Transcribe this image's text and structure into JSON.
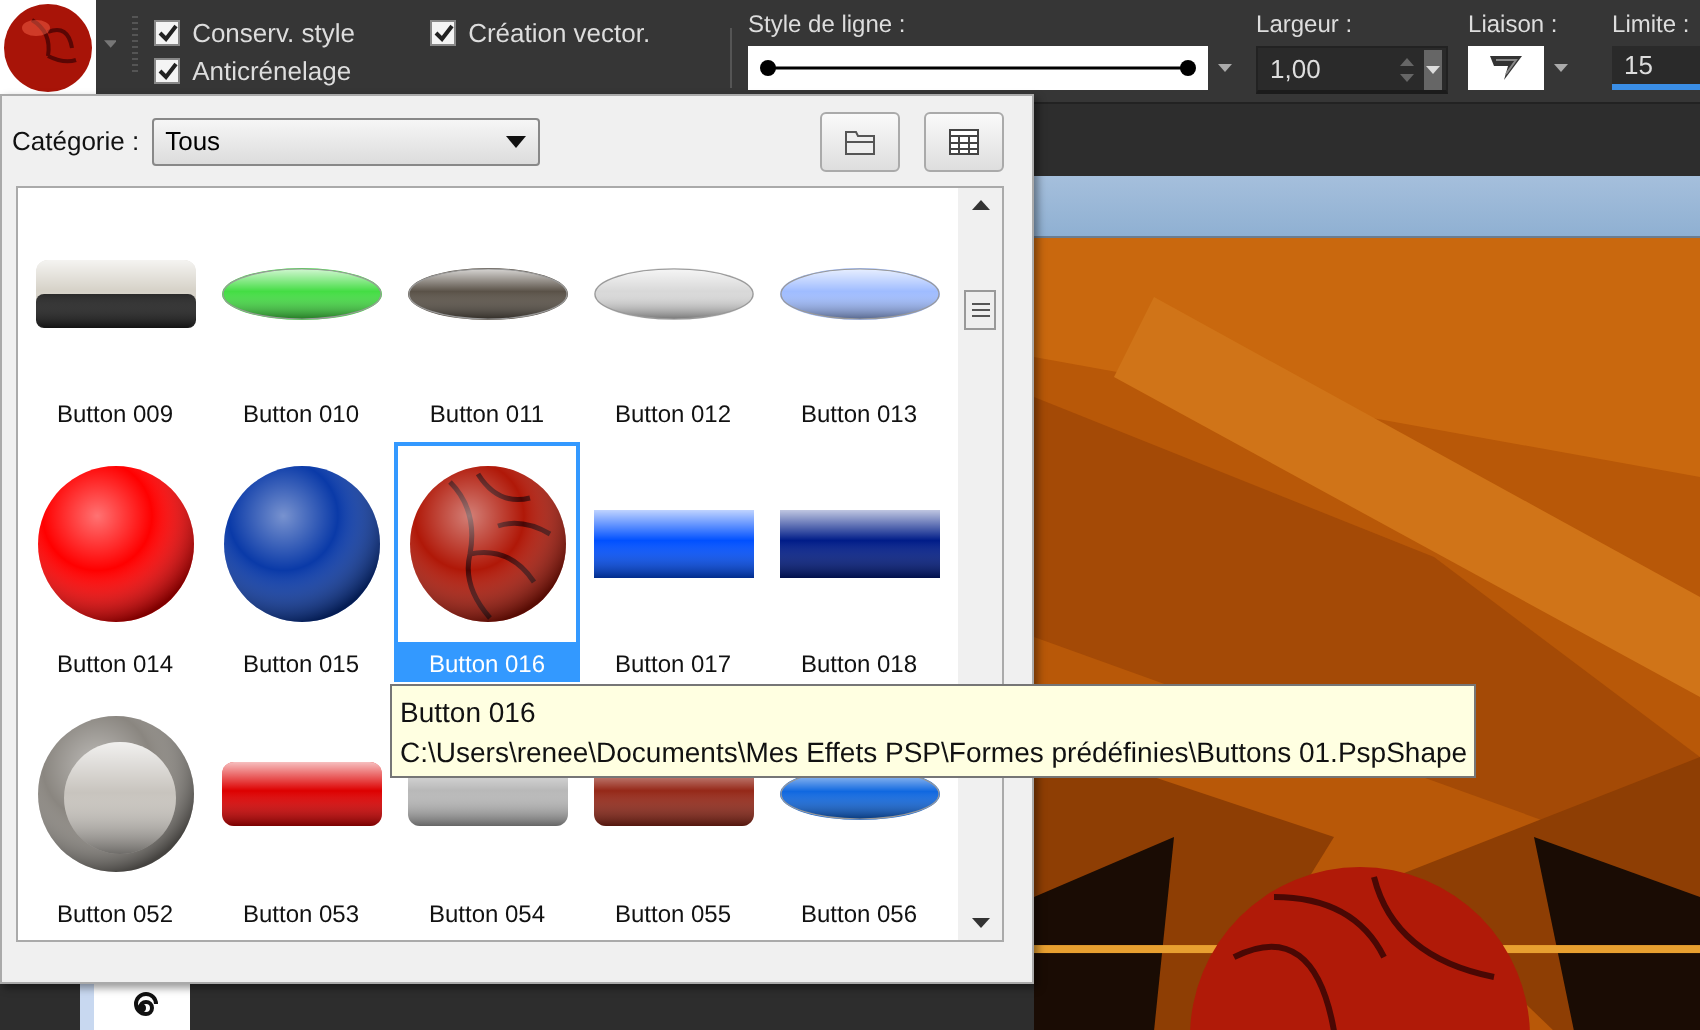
{
  "toolbar": {
    "checkboxes": [
      {
        "label": "Conserv. style",
        "checked": true
      },
      {
        "label": "Création vector.",
        "checked": true
      },
      {
        "label": "Anticrénelage",
        "checked": true
      }
    ],
    "line_style": {
      "label": "Style de ligne :"
    },
    "width": {
      "label": "Largeur :",
      "value": "1,00"
    },
    "join": {
      "label": "Liaison :"
    },
    "limit": {
      "label": "Limite :",
      "value": "15"
    }
  },
  "shape_picker": {
    "category_label": "Catégorie :",
    "category": "Tous",
    "shapes": [
      {
        "name": "Button 009",
        "kind": "block",
        "color": "#d6d2c8",
        "selected": false
      },
      {
        "name": "Button 010",
        "kind": "ellipse",
        "color": "#44dd44",
        "selected": false
      },
      {
        "name": "Button 011",
        "kind": "ellipse",
        "color": "#5a5248",
        "selected": false
      },
      {
        "name": "Button 012",
        "kind": "ellipse",
        "color": "#d8d8d8",
        "selected": false
      },
      {
        "name": "Button 013",
        "kind": "ellipse",
        "color": "#9fbcff",
        "selected": false
      },
      {
        "name": "Button 014",
        "kind": "sphere",
        "color": "#ff0000",
        "selected": false
      },
      {
        "name": "Button 015",
        "kind": "sphere",
        "color": "#0a3aa8",
        "selected": false
      },
      {
        "name": "Button 016",
        "kind": "marbled-sphere",
        "color": "#b01808",
        "selected": true
      },
      {
        "name": "Button 017",
        "kind": "bar",
        "color": "#0050ff",
        "selected": false
      },
      {
        "name": "Button 018",
        "kind": "bar",
        "color": "#001c88",
        "selected": false
      },
      {
        "name": "Button 052",
        "kind": "ring",
        "color": "#8a8680",
        "selected": false
      },
      {
        "name": "Button 053",
        "kind": "rounded",
        "color": "#dd0000",
        "selected": false
      },
      {
        "name": "Button 054",
        "kind": "rounded",
        "color": "#b8b8b8",
        "selected": false
      },
      {
        "name": "Button 055",
        "kind": "rounded",
        "color": "#952818",
        "selected": false
      },
      {
        "name": "Button 056",
        "kind": "ellipse",
        "color": "#1068e0",
        "selected": false
      }
    ],
    "tooltip": {
      "title": "Button 016",
      "path": "C:\\Users\\renee\\Documents\\Mes Effets PSP\\Formes prédéfinies\\Buttons 01.PspShape"
    }
  }
}
